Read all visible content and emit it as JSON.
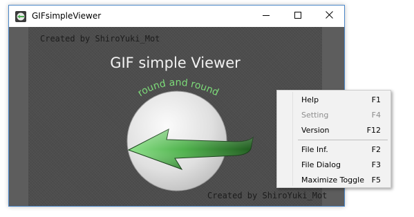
{
  "window": {
    "title": "GIFsimpleViewer",
    "icon": "app-icon",
    "controls": [
      "minimize-icon",
      "maximize-icon",
      "close-icon"
    ]
  },
  "content": {
    "credit_top": "Created by ShiroYuki_Mot",
    "title": "GIF simple Viewer",
    "subtitle": "round and round",
    "credit_bottom": "Created by ShiroYuki_Mot"
  },
  "menu": {
    "items": [
      {
        "label": "Help",
        "shortcut": "F1",
        "enabled": true
      },
      {
        "label": "Setting",
        "shortcut": "F4",
        "enabled": false
      },
      {
        "label": "Version",
        "shortcut": "F12",
        "enabled": true
      },
      {
        "label": "File Inf.",
        "shortcut": "F2",
        "enabled": true
      },
      {
        "label": "File Dialog",
        "shortcut": "F3",
        "enabled": true
      },
      {
        "label": "Maximize Toggle",
        "shortcut": "F5",
        "enabled": true
      }
    ]
  },
  "colors": {
    "arrow": "#5fc45a",
    "background": "#4d4d4d",
    "menu_bg": "#f2f2f2"
  }
}
